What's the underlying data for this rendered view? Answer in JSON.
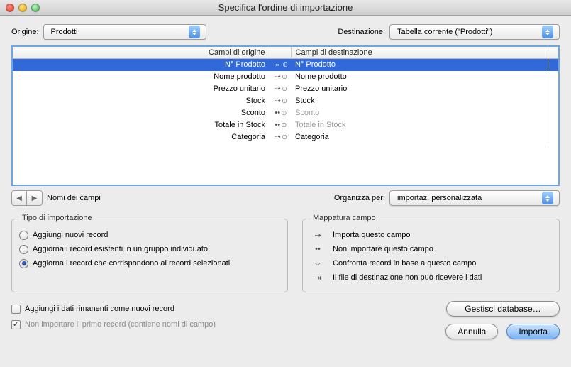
{
  "window": {
    "title": "Specifica l'ordine di importazione"
  },
  "top": {
    "origin_label": "Origine:",
    "origin_value": "Prodotti",
    "dest_label": "Destinazione:",
    "dest_value": "Tabella corrente (\"Prodotti\")"
  },
  "columns": {
    "source": "Campi di origine",
    "dest": "Campi di destinazione"
  },
  "rows": [
    {
      "src": "N° Prodotto",
      "map": "match",
      "dst": "N° Prodotto",
      "dim": false,
      "selected": true
    },
    {
      "src": "Nome prodotto",
      "map": "import",
      "dst": "Nome prodotto",
      "dim": false
    },
    {
      "src": "Prezzo unitario",
      "map": "import",
      "dst": "Prezzo unitario",
      "dim": false
    },
    {
      "src": "Stock",
      "map": "import",
      "dst": "Stock",
      "dim": false
    },
    {
      "src": "Sconto",
      "map": "skip",
      "dst": "Sconto",
      "dim": true
    },
    {
      "src": "Totale in Stock",
      "map": "skip",
      "dst": "Totale in Stock",
      "dim": true
    },
    {
      "src": "Categoria",
      "map": "import",
      "dst": "Categoria",
      "dim": false
    }
  ],
  "glyphs": {
    "import": "⇢",
    "skip": "••",
    "match": "⇔",
    "noreceive": "⇥",
    "sort": "⦶"
  },
  "below": {
    "names_label": "Nomi dei campi",
    "organize_label": "Organizza per:",
    "organize_value": "importaz. personalizzata"
  },
  "import_type": {
    "legend": "Tipo di importazione",
    "options": [
      "Aggiungi nuovi record",
      "Aggiorna i record esistenti in un gruppo individuato",
      "Aggiorna i record che corrispondono ai record selezionati"
    ],
    "selected": 2
  },
  "mapping_legend": {
    "legend": "Mappatura campo",
    "items": [
      {
        "glyph": "import",
        "label": "Importa questo campo"
      },
      {
        "glyph": "skip",
        "label": "Non importare questo campo"
      },
      {
        "glyph": "match",
        "label": "Confronta record in base a questo campo"
      },
      {
        "glyph": "noreceive",
        "label": "Il file di destinazione non può ricevere i dati"
      }
    ]
  },
  "bottom": {
    "add_remaining": "Aggiungi i dati rimanenti come nuovi record",
    "add_remaining_checked": false,
    "skip_first": "Non importare il primo record (contiene nomi di campo)",
    "skip_first_checked": true,
    "skip_first_disabled": true,
    "manage_db": "Gestisci database…",
    "cancel": "Annulla",
    "import": "Importa"
  }
}
